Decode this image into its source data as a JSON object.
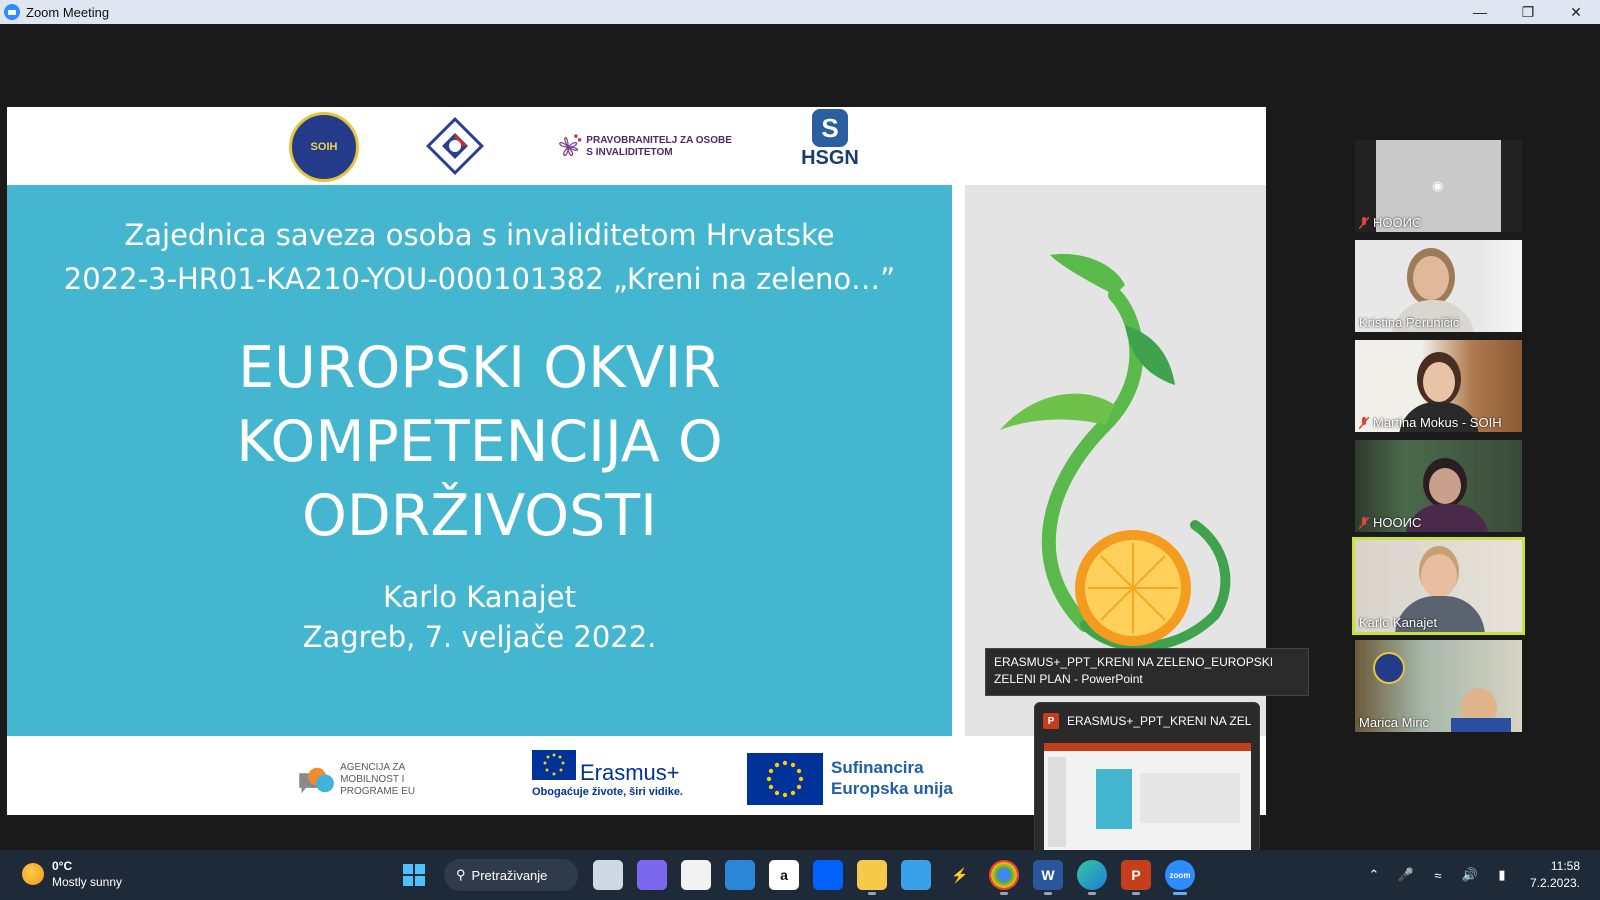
{
  "window": {
    "title": "Zoom Meeting"
  },
  "slide": {
    "logo_prav_text": "PRAVOBRANITELJ ZA OSOBE S INVALIDITETOM",
    "logo_hsgn_text": "HSGN",
    "logo_soih_text": "SOIH",
    "organization_line1": "Zajednica saveza osoba s invaliditetom Hrvatske",
    "organization_line2": "2022-3-HR01-KA210-YOU-000101382 „Kreni na zeleno…”",
    "title_line1": "EUROPSKI OKVIR",
    "title_line2": "KOMPETENCIJA O",
    "title_line3": "ODRŽIVOSTI",
    "author": "Karlo Kanajet",
    "place_date": "Zagreb, 7. veljače 2022.",
    "amp_text": "AGENCIJA ZA MOBILNOST I PROGRAME EU",
    "erasmus_name": "Erasmus+",
    "erasmus_tagline": "Obogaćuje živote, širi vidike.",
    "sufin_line1": "Sufinancira",
    "sufin_line2": "Europska unija"
  },
  "participants": [
    {
      "name": "НООИС",
      "muted": true,
      "video": false
    },
    {
      "name": "Kristina Peruničić",
      "muted": false,
      "video": true
    },
    {
      "name": "Martina Mokus - SOIH",
      "muted": true,
      "video": true
    },
    {
      "name": "НООИС",
      "muted": true,
      "video": true
    },
    {
      "name": "Karlo Kanajet",
      "muted": false,
      "video": true,
      "active": true
    },
    {
      "name": "Marica Mirić",
      "muted": false,
      "video": true
    }
  ],
  "tooltip": {
    "text": "ERASMUS+_PPT_KRENI NA ZELENO_EUROPSKI ZELENI PLAN - PowerPoint"
  },
  "thumbnail": {
    "title": "ERASMUS+_PPT_KRENI NA ZEL...",
    "app_badge": "P"
  },
  "taskbar": {
    "weather_temp": "0°C",
    "weather_desc": "Mostly sunny",
    "search_label": "Pretraživanje",
    "time": "11:58",
    "date": "7.2.2023."
  }
}
